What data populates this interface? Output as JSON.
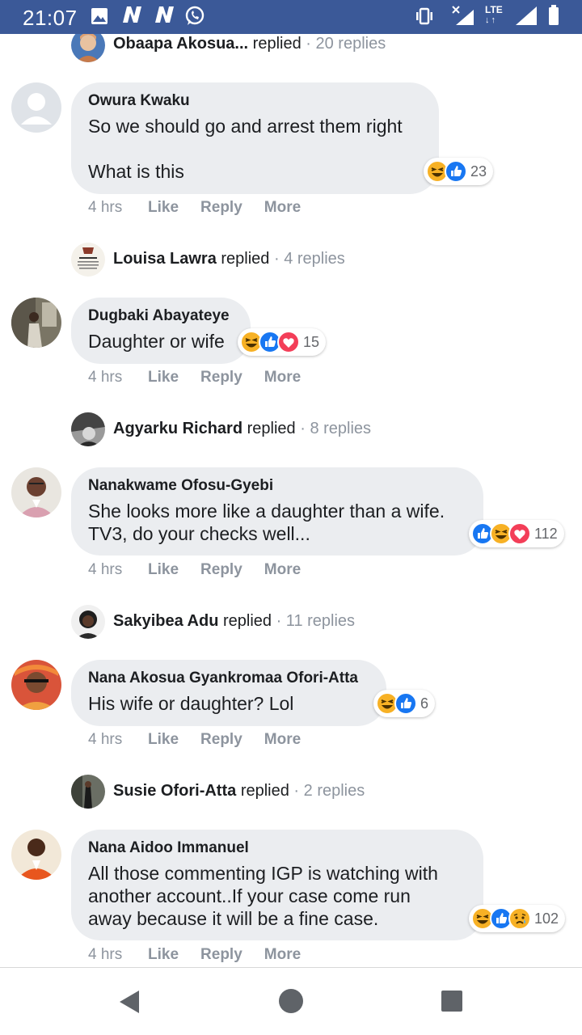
{
  "status_bar": {
    "time": "21:07",
    "icons": [
      "image-icon",
      "n-icon",
      "n-icon",
      "whatsapp-icon",
      "vibrate-icon",
      "no-signal-icon",
      "lte-icon",
      "signal-icon",
      "battery-icon"
    ],
    "lte_label": "LTE",
    "lte_arrows": "↓↑"
  },
  "colors": {
    "status_bar_bg": "#3b5998",
    "bubble_bg": "#ebedf0",
    "meta_text": "#8d949e",
    "like_blue": "#1877f2",
    "haha_yellow": "#f7b125",
    "love_red": "#f33e58"
  },
  "threads": [
    {
      "reply_preview": {
        "name": "Obaapa Akosua...",
        "replied": "replied",
        "count": "· 20 replies"
      }
    },
    {
      "author": "Owura Kwaku",
      "text": "So we should go and arrest them right\n\nWhat is this",
      "reactions": [
        "haha",
        "like"
      ],
      "reaction_count": "23",
      "time": "4 hrs",
      "like": "Like",
      "reply": "Reply",
      "more": "More",
      "reply_preview": {
        "name": "Louisa Lawra",
        "replied": "replied",
        "count": "· 4 replies"
      }
    },
    {
      "author": "Dugbaki Abayateye",
      "text": "Daughter or wife",
      "reactions": [
        "haha",
        "like",
        "love"
      ],
      "reaction_count": "15",
      "time": "4 hrs",
      "like": "Like",
      "reply": "Reply",
      "more": "More",
      "reply_preview": {
        "name": "Agyarku Richard",
        "replied": "replied",
        "count": "· 8 replies"
      }
    },
    {
      "author": "Nanakwame Ofosu-Gyebi",
      "text": "She looks more like a daughter than a wife.\nTV3, do your checks well...",
      "reactions": [
        "like",
        "haha",
        "love"
      ],
      "reaction_count": "112",
      "time": "4 hrs",
      "like": "Like",
      "reply": "Reply",
      "more": "More",
      "reply_preview": {
        "name": "Sakyibea Adu",
        "replied": "replied",
        "count": "· 11 replies"
      }
    },
    {
      "author": "Nana Akosua Gyankromaa Ofori-Atta",
      "text": "His wife or daughter? Lol",
      "reactions": [
        "haha",
        "like"
      ],
      "reaction_count": "6",
      "time": "4 hrs",
      "like": "Like",
      "reply": "Reply",
      "more": "More",
      "reply_preview": {
        "name": "Susie Ofori-Atta",
        "replied": "replied",
        "count": "· 2 replies"
      }
    },
    {
      "author": "Nana Aidoo Immanuel",
      "text": "All those commenting IGP is watching with\nanother account..If your case come run\naway because it will be a fine case.",
      "reactions": [
        "haha",
        "like",
        "sad"
      ],
      "reaction_count": "102",
      "time": "4 hrs",
      "like": "Like",
      "reply": "Reply",
      "more": "More"
    }
  ],
  "nav_bar": {
    "icons": [
      "back-icon",
      "home-icon",
      "recents-icon"
    ]
  }
}
